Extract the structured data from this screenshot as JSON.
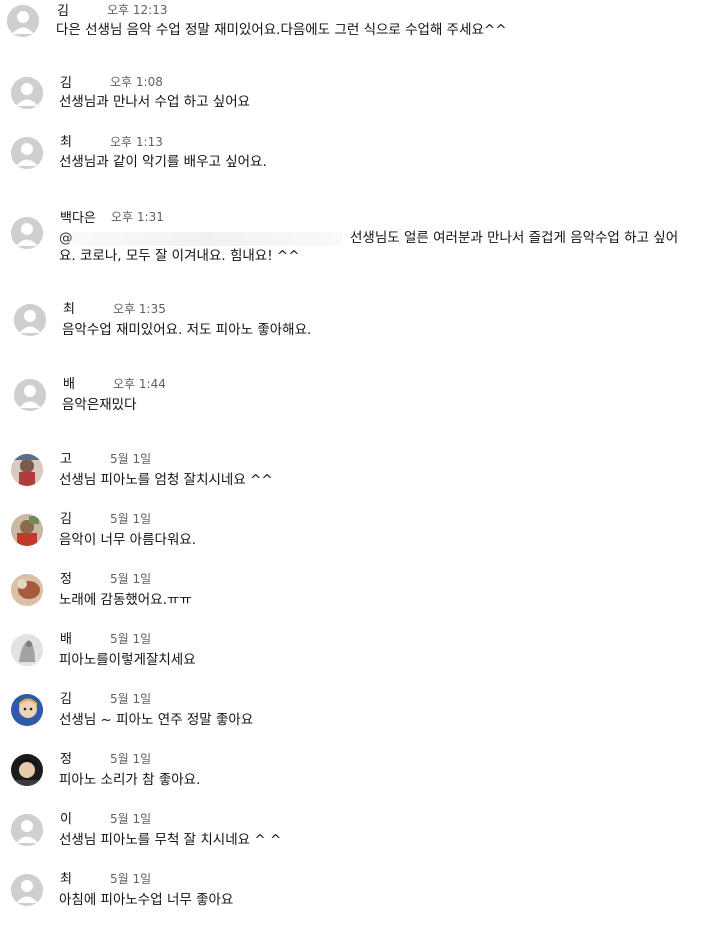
{
  "colors": {
    "background": "#ffffff",
    "text": "#111111",
    "timestamp": "#606060",
    "default_avatar_bg": "#cfcfcf",
    "default_avatar_fg": "#ffffff"
  },
  "comments": [
    {
      "author": "김",
      "time": "오후 12:13",
      "text": "다은 선생님 음악 수업 정말 재미있어요.다음에도 그런 식으로 수업해 주세요^^",
      "avatar": "default-avatar-icon"
    },
    {
      "author": "김",
      "time": "오후 1:08",
      "text": "선생님과 만나서 수업 하고 싶어요",
      "avatar": "default-avatar-icon"
    },
    {
      "author": "최",
      "time": "오후 1:13",
      "text": "선생님과 같이 악기를 배우고 싶어요.",
      "avatar": "default-avatar-icon"
    },
    {
      "author": "백다은",
      "time": "오후 1:31",
      "mention": "@",
      "text_line1": "선생님도 얼른 여러분과 만나서 즐겁게 음악수업 하고 싶어",
      "text_line2": "요. 코로나, 모두 잘 이겨내요. 힘내요! ^^",
      "avatar": "default-avatar-icon"
    },
    {
      "author": "최",
      "time": "오후 1:35",
      "text": "음악수업 재미있어요. 저도 피아노 좋아해요.",
      "avatar": "default-avatar-icon"
    },
    {
      "author": "배",
      "time": "오후 1:44",
      "text": "음악은재밌다",
      "avatar": "default-avatar-icon"
    },
    {
      "author": "고",
      "time": "5월 1일",
      "text": "선생님 피아노를 엄청 잘치시네요 ^^",
      "avatar": "photo-avatar-icon"
    },
    {
      "author": "김",
      "time": "5월 1일",
      "text": "음악이 너무 아름다워요.",
      "avatar": "photo-avatar-icon"
    },
    {
      "author": "정",
      "time": "5월 1일",
      "text": "노래에 감동했어요.ㅠㅠ",
      "avatar": "photo-avatar-icon"
    },
    {
      "author": "배",
      "time": "5월 1일",
      "text": "피아노를이렇게잘치세요",
      "avatar": "photo-avatar-icon"
    },
    {
      "author": "김",
      "time": "5월 1일",
      "text": "선생님 ~ 피아노 연주 정말 좋아요",
      "avatar": "photo-avatar-icon"
    },
    {
      "author": "정",
      "time": "5월 1일",
      "text": "피아노 소리가 참 좋아요.",
      "avatar": "photo-avatar-icon"
    },
    {
      "author": "이",
      "time": "5월 1일",
      "text": "선생님 피아노를 무척 잘 치시네요 ^ ^",
      "avatar": "default-avatar-icon"
    },
    {
      "author": "최",
      "time": "5월 1일",
      "text": "아침에 피아노수업 너무 좋아요",
      "avatar": "default-avatar-icon"
    }
  ]
}
